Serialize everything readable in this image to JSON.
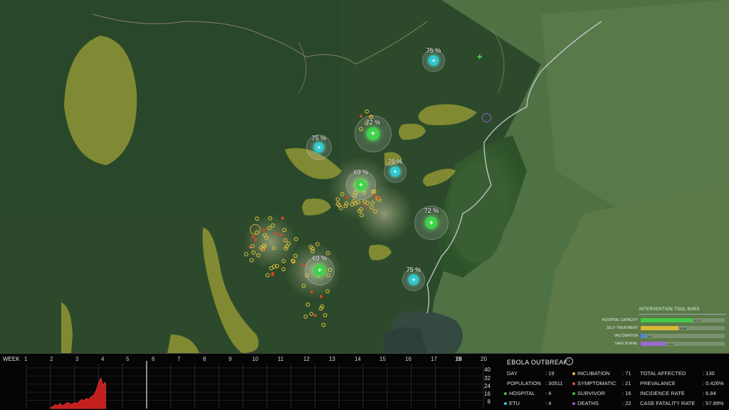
{
  "colors": {
    "hub_cyan": "#2fc9d0",
    "hub_green": "#3fd24a",
    "case_yellow": "#e0c23a",
    "case_red": "#d04a2a",
    "overlay_yellow": "#c8bf3a",
    "chart_red": "#c41f1f"
  },
  "map": {
    "hubs": [
      {
        "name": "etu-hub-north",
        "type": "cyan",
        "percent": "75 %"
      },
      {
        "name": "hospital-hub-north",
        "type": "green",
        "percent": "72 %"
      },
      {
        "name": "etu-hub-west",
        "type": "cyan",
        "percent": "75 %"
      },
      {
        "name": "etu-hub-center-east",
        "type": "cyan",
        "percent": "75 %"
      },
      {
        "name": "hospital-hub-center",
        "type": "green",
        "percent": "69 %"
      },
      {
        "name": "hospital-hub-east",
        "type": "green",
        "percent": "72 %"
      },
      {
        "name": "hospital-hub-southwest",
        "type": "green",
        "percent": "69 %"
      },
      {
        "name": "etu-hub-south",
        "type": "cyan",
        "percent": "75 %"
      }
    ]
  },
  "intervention_tools": {
    "title": "INTERVENTION TOOL BARS",
    "bars": [
      {
        "label": "HOSPITAL CAPACITY",
        "value": "% 72",
        "level": 0.62,
        "color": "#44c84a"
      },
      {
        "label": "SELF TREATMENT",
        "value": "% 45",
        "level": 0.45,
        "color": "#d8b83a"
      },
      {
        "label": "VACCINATION",
        "value": "% 6",
        "level": 0.06,
        "color": "#4a86d6"
      },
      {
        "label": "SAFE BURIAL",
        "value": "% 34",
        "level": 0.3,
        "color": "#9a6ad0"
      }
    ]
  },
  "timeline": {
    "week_label": "WEEK",
    "weeks": [
      "1",
      "2",
      "3",
      "4",
      "5",
      "6",
      "7",
      "8",
      "9",
      "10",
      "11",
      "12",
      "13",
      "14",
      "15",
      "16",
      "17",
      "18",
      "19",
      "20"
    ],
    "current_week": 6,
    "y_ticks": [
      "40",
      "32",
      "24",
      "16",
      "8"
    ]
  },
  "chart_data": {
    "type": "area",
    "x_unit": "week",
    "x": [
      2.0,
      2.1,
      2.2,
      2.3,
      2.4,
      2.5,
      2.6,
      2.7,
      2.8,
      2.9,
      3.0,
      3.1,
      3.2,
      3.3,
      3.4,
      3.5,
      3.6,
      3.7,
      3.8,
      3.9,
      4.0,
      4.05,
      4.1,
      4.15,
      4.2,
      4.25,
      4.3
    ],
    "values": [
      1,
      2,
      4,
      3,
      5,
      3,
      4,
      6,
      5,
      4,
      6,
      5,
      7,
      9,
      8,
      10,
      9,
      12,
      13,
      18,
      25,
      28,
      30,
      26,
      22,
      26,
      24
    ],
    "ylim": [
      0,
      44
    ],
    "xlim": [
      1,
      20
    ],
    "grid": true
  },
  "stats": {
    "title": "EBOLA OUTBREAK",
    "info_icon": "info-icon",
    "day_label": "DAY",
    "day_value": ": 19",
    "population_label": "POPULATION",
    "population_value": ": 30511",
    "hospital_label": "HOSPITAL",
    "hospital_value": ": 4",
    "etu_label": "ETU",
    "etu_value": ": 4",
    "incubation_label": "INCUBATION",
    "incubation_value": ": 71",
    "symptomatic_label": "SYMPTOMATIC",
    "symptomatic_value": ": 21",
    "survivor_label": "SURVIVOR",
    "survivor_value": ": 16",
    "deaths_label": "DEATHS",
    "deaths_value": ": 22",
    "total_label": "TOTAL AFFECTED",
    "total_value": ": 130",
    "prevalance_label": "PREVALANCE",
    "prevalance_value": ": 0.426%",
    "incidence_label": "INCIDENCE RATE",
    "incidence_value": ": 6.84",
    "cfr_label": "CASE FATALITY RATE",
    "cfr_value": ": 57.89%",
    "dot_colors": {
      "hospital": "#3fbf4a",
      "etu": "#2fc9d0",
      "incubation": "#e0c23a",
      "symptomatic": "#d0503a",
      "survivor": "#3fbf4a",
      "deaths": "#9a5ad0"
    }
  }
}
